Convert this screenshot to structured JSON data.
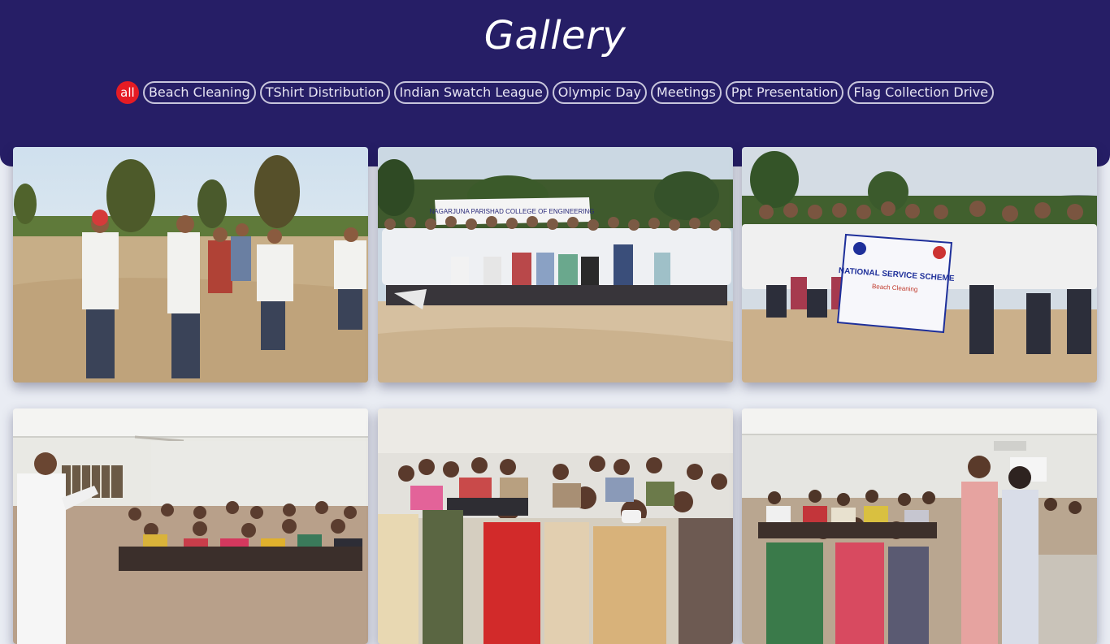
{
  "page": {
    "title": "Gallery"
  },
  "filters": [
    {
      "label": "all",
      "active": true
    },
    {
      "label": "Beach Cleaning",
      "active": false
    },
    {
      "label": "TShirt Distribution",
      "active": false
    },
    {
      "label": "Indian Swatch League",
      "active": false
    },
    {
      "label": "Olympic Day",
      "active": false
    },
    {
      "label": "Meetings",
      "active": false
    },
    {
      "label": "Ppt Presentation",
      "active": false
    },
    {
      "label": "Flag Collection Drive",
      "active": false
    }
  ],
  "photos": [
    {
      "category": "beach-cleaning"
    },
    {
      "category": "beach-cleaning",
      "banner_text": "NAGARJUNA PARISHAD COLLEGE OF ENGINEERING"
    },
    {
      "category": "beach-cleaning",
      "banner_text": "NATIONAL SERVICE SCHEME",
      "banner_subtext": "Beach Cleaning"
    },
    {
      "category": "meetings"
    },
    {
      "category": "meetings"
    },
    {
      "category": "meetings"
    }
  ],
  "colors": {
    "header_bg": "#261e66",
    "active_chip": "#e51c24",
    "page_bg": "#e9ecf3"
  }
}
